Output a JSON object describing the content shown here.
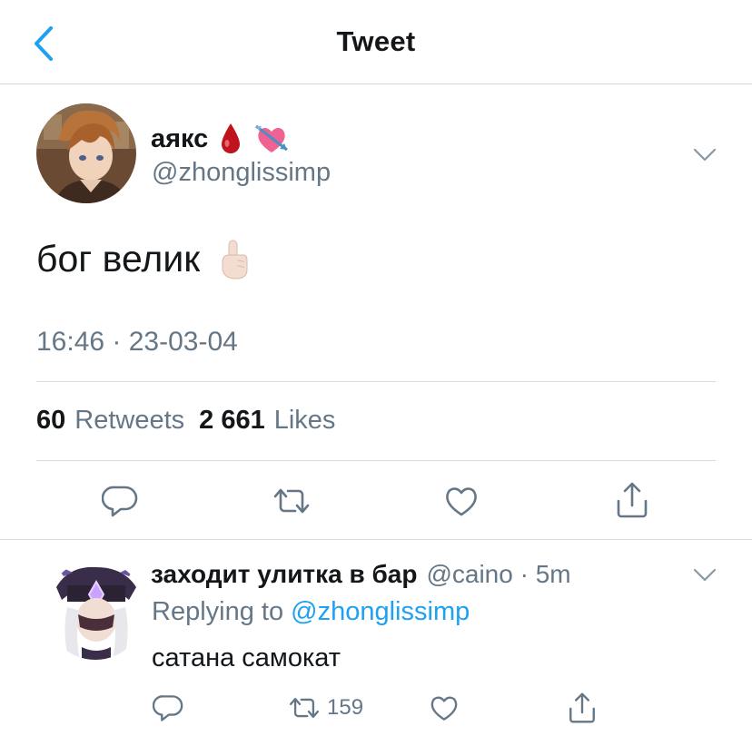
{
  "header": {
    "title": "Tweet",
    "back_icon": "chevron-left-icon"
  },
  "tweet": {
    "author_name": "аякс",
    "author_emojis": [
      "drop-of-blood-emoji",
      "heart-with-arrow-emoji"
    ],
    "handle": "@zhonglissimp",
    "text": "бог велик",
    "text_emoji": "index-pointing-up-emoji",
    "timestamp": "16:46 · 23-03-04",
    "retweets_count": "60",
    "retweets_label": "Retweets",
    "likes_count": "2 661",
    "likes_label": "Likes",
    "actions": [
      "reply-icon",
      "retweet-icon",
      "like-icon",
      "share-icon"
    ]
  },
  "reply": {
    "author_name": "заходит улитка в бар",
    "meta": "@caino · 5m",
    "replying_prefix": "Replying to",
    "replying_handle": "@zhonglissimp",
    "text": "сатана самокат",
    "retweets_count": "159"
  },
  "colors": {
    "accent": "#1da1f2",
    "muted": "#657786",
    "text": "#14171a",
    "divider": "#dadcde",
    "back_arrow": "#1da1f2"
  }
}
